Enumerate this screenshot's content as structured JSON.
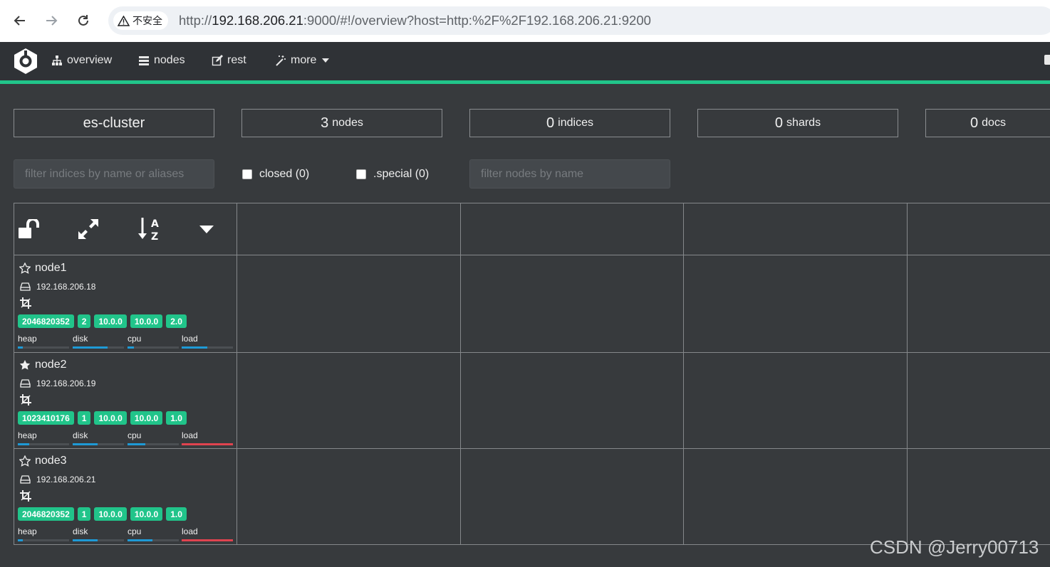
{
  "browser": {
    "security_label": "不安全",
    "url_prefix": "http://",
    "url_host": "192.168.206.21",
    "url_rest": ":9000/#!/overview?host=http:%2F%2F192.168.206.21:9200"
  },
  "app_nav": {
    "items": [
      {
        "label": "overview",
        "icon": "sitemap-icon"
      },
      {
        "label": "nodes",
        "icon": "server-icon"
      },
      {
        "label": "rest",
        "icon": "edit-icon"
      },
      {
        "label": "more",
        "icon": "magic-wand-icon"
      }
    ],
    "accent_color": "#21c48a"
  },
  "stats": {
    "cluster_name": "es-cluster",
    "nodes": {
      "value": "3",
      "label": "nodes"
    },
    "indices": {
      "value": "0",
      "label": "indices"
    },
    "shards": {
      "value": "0",
      "label": "shards"
    },
    "docs": {
      "value": "0",
      "label": "docs"
    }
  },
  "filters": {
    "indices_placeholder": "filter indices by name or aliases",
    "closed_label": "closed (0)",
    "special_label": ".special (0)",
    "nodes_placeholder": "filter nodes by name"
  },
  "toolbar": {
    "icons": [
      "unlock-icon",
      "expand-icon",
      "sort-alpha-icon",
      "caret-down-icon"
    ]
  },
  "nodes": [
    {
      "name": "node1",
      "master": false,
      "ip": "192.168.206.18",
      "badges": [
        "2046820352",
        "2",
        "10.0.0",
        "10.0.0",
        "2.0"
      ],
      "metrics": [
        {
          "label": "heap",
          "fraction": 0.1,
          "color": "#1e9ad6"
        },
        {
          "label": "disk",
          "fraction": 0.68,
          "color": "#1e9ad6"
        },
        {
          "label": "cpu",
          "fraction": 0.12,
          "color": "#1e9ad6"
        },
        {
          "label": "load",
          "fraction": 0.5,
          "color": "#1e9ad6"
        }
      ]
    },
    {
      "name": "node2",
      "master": true,
      "ip": "192.168.206.19",
      "badges": [
        "1023410176",
        "1",
        "10.0.0",
        "10.0.0",
        "1.0"
      ],
      "metrics": [
        {
          "label": "heap",
          "fraction": 0.22,
          "color": "#1e9ad6"
        },
        {
          "label": "disk",
          "fraction": 0.48,
          "color": "#1e9ad6"
        },
        {
          "label": "cpu",
          "fraction": 0.35,
          "color": "#1e9ad6"
        },
        {
          "label": "load",
          "fraction": 1.0,
          "color": "#e0434f"
        }
      ]
    },
    {
      "name": "node3",
      "master": false,
      "ip": "192.168.206.21",
      "badges": [
        "2046820352",
        "1",
        "10.0.0",
        "10.0.0",
        "1.0"
      ],
      "metrics": [
        {
          "label": "heap",
          "fraction": 0.1,
          "color": "#1e9ad6"
        },
        {
          "label": "disk",
          "fraction": 0.48,
          "color": "#1e9ad6"
        },
        {
          "label": "cpu",
          "fraction": 0.48,
          "color": "#1e9ad6"
        },
        {
          "label": "load",
          "fraction": 1.0,
          "color": "#e0434f"
        }
      ]
    }
  ],
  "watermark": "CSDN @Jerry00713"
}
